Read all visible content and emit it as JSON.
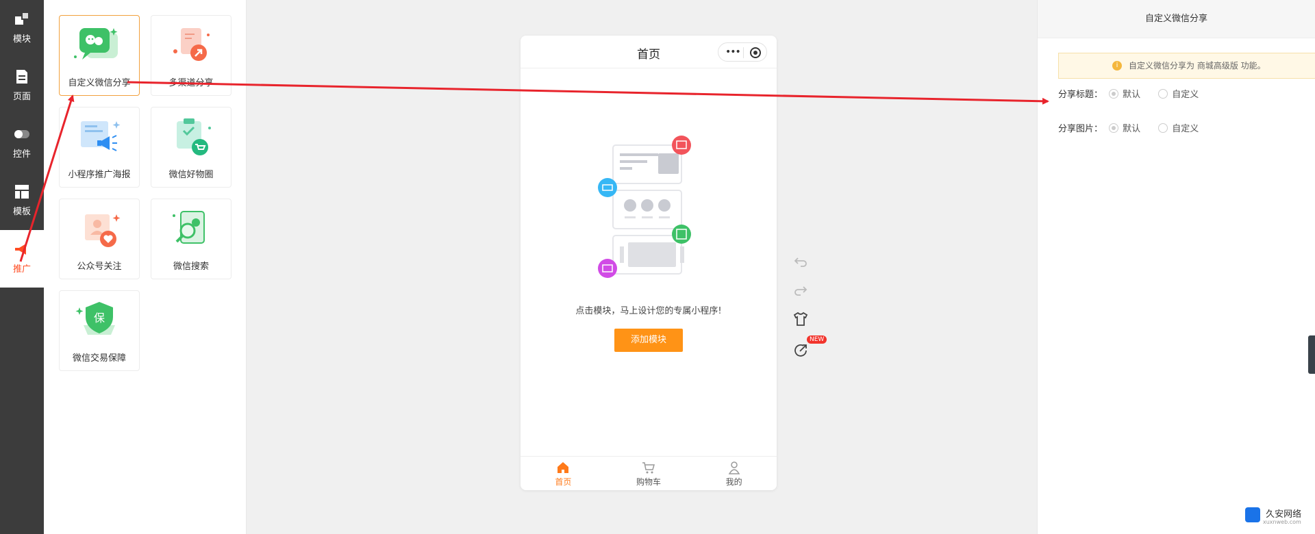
{
  "left_nav": {
    "items": [
      {
        "label": "模块",
        "icon": "blocks-icon"
      },
      {
        "label": "页面",
        "icon": "page-icon"
      },
      {
        "label": "控件",
        "icon": "toggle-icon"
      },
      {
        "label": "模板",
        "icon": "template-icon"
      },
      {
        "label": "推广",
        "icon": "megaphone-icon",
        "active": true
      }
    ]
  },
  "modules": [
    {
      "label": "自定义微信分享",
      "icon": "wechat-share-icon",
      "selected": true
    },
    {
      "label": "多渠道分享",
      "icon": "multi-channel-share-icon"
    },
    {
      "label": "小程序推广海报",
      "icon": "poster-icon"
    },
    {
      "label": "微信好物圈",
      "icon": "wechat-goods-circle-icon"
    },
    {
      "label": "公众号关注",
      "icon": "follow-account-icon"
    },
    {
      "label": "微信搜索",
      "icon": "wechat-search-icon"
    },
    {
      "label": "微信交易保障",
      "icon": "trade-guarantee-icon",
      "badge_text": "保"
    }
  ],
  "phone": {
    "title": "首页",
    "empty_text": "点击模块，马上设计您的专属小程序!",
    "add_button": "添加模块",
    "tabs": [
      {
        "label": "首页",
        "icon": "home-icon",
        "active": true
      },
      {
        "label": "购物车",
        "icon": "cart-icon"
      },
      {
        "label": "我的",
        "icon": "user-icon"
      }
    ]
  },
  "tools": {
    "new_badge": "NEW"
  },
  "settings": {
    "title": "自定义微信分享",
    "notice": "自定义微信分享为 商城高级版 功能。",
    "rows": [
      {
        "label": "分享标题：",
        "options": [
          "默认",
          "自定义"
        ],
        "selected": "默认"
      },
      {
        "label": "分享图片：",
        "options": [
          "默认",
          "自定义"
        ],
        "selected": "默认"
      }
    ]
  },
  "watermark": {
    "brand": "久安网络",
    "domain": "xuxnweb.com"
  },
  "colors": {
    "nav_bg": "#3c3c3c",
    "accent": "#ff9316",
    "active_red": "#ff4c22",
    "arrow": "#e8242c"
  }
}
